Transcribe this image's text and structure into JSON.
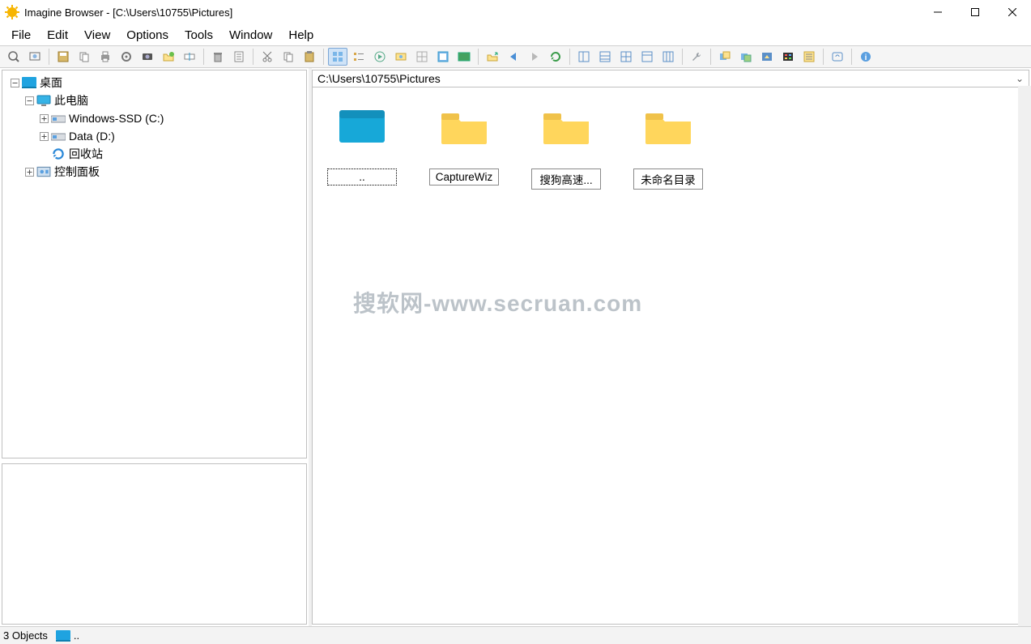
{
  "window": {
    "title": "Imagine Browser - [C:\\Users\\10755\\Pictures]"
  },
  "menu": {
    "file": "File",
    "edit": "Edit",
    "view": "View",
    "options": "Options",
    "tools": "Tools",
    "window": "Window",
    "help": "Help"
  },
  "tree": {
    "desktop": "桌面",
    "thispc": "此电脑",
    "drive_c": "Windows-SSD (C:)",
    "drive_d": "Data (D:)",
    "recycle": "回收站",
    "control": "控制面板"
  },
  "pathbar": {
    "path": "C:\\Users\\10755\\Pictures"
  },
  "items": {
    "up": "..",
    "a": "CaptureWiz",
    "b": "搜狗高速...",
    "c": "未命名目录"
  },
  "watermark": "搜软网-www.secruan.com",
  "status": {
    "objects": "3 Objects",
    "sel": ".."
  }
}
